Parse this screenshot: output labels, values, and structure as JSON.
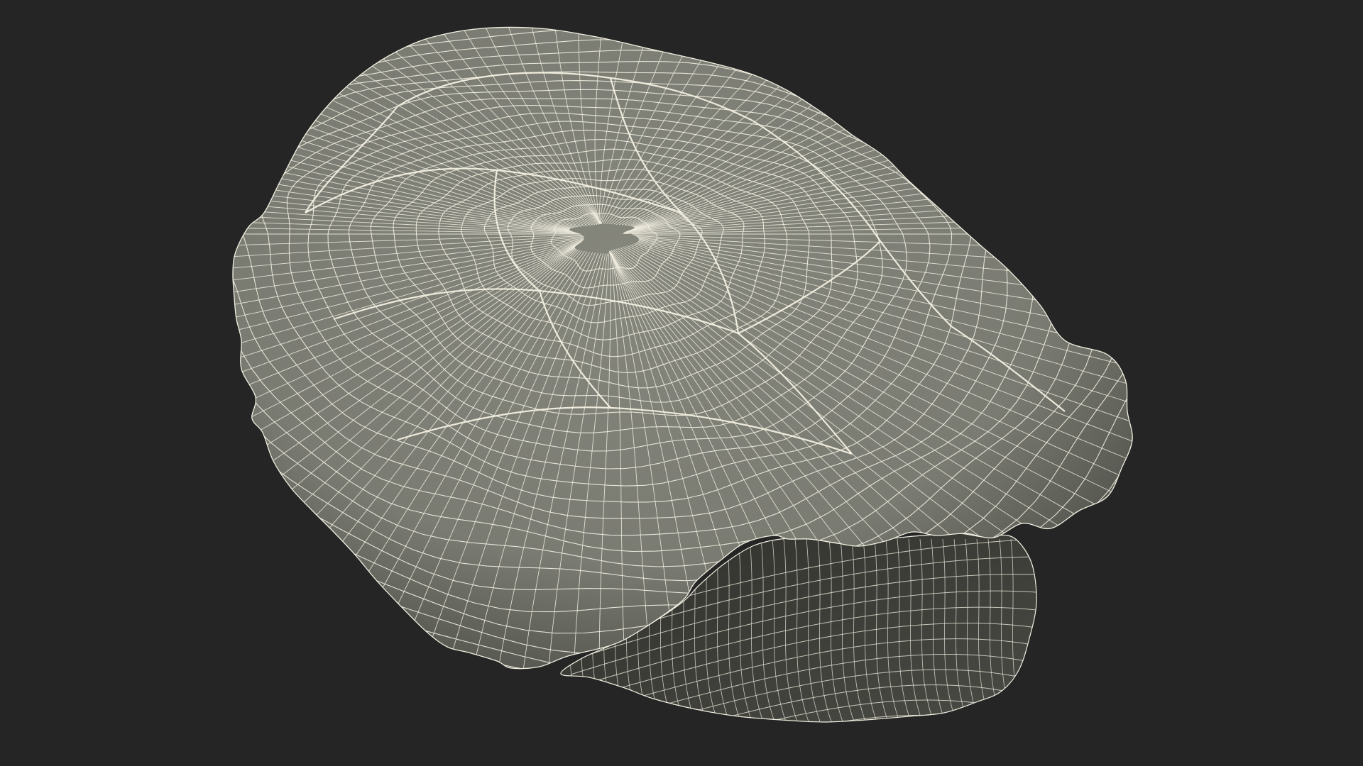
{
  "scene": {
    "subject_icon": "turtle-shell-wireframe-icon",
    "background_color": "#252525",
    "surface_color": "#7a7b72",
    "surface_shadow_color": "#4a4b45",
    "underside_color": "#3d3e38",
    "underside_inner_color": "#2f302b",
    "wire_color": "#f3f0e2",
    "shading": "wireframe-over-shaded"
  }
}
